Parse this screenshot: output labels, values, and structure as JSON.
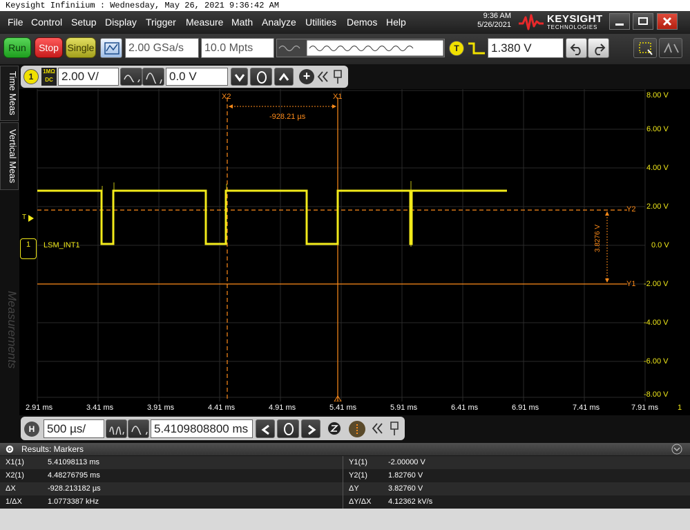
{
  "titlebar": {
    "text": "Keysight Infiniium : Wednesday, May 26, 2021 9:36:42 AM"
  },
  "menu": [
    "File",
    "Control",
    "Setup",
    "Display",
    "Trigger",
    "Measure",
    "Math",
    "Analyze",
    "Utilities",
    "Demos",
    "Help"
  ],
  "clock": {
    "time": "9:36 AM",
    "date": "5/26/2021"
  },
  "brand": {
    "name": "KEYSIGHT",
    "sub": "TECHNOLOGIES"
  },
  "toolbar": {
    "run": "Run",
    "stop": "Stop",
    "single": "Single",
    "sample_rate": "2.00 GSa/s",
    "memory_depth": "10.0 Mpts",
    "trigger_badge": "T",
    "trigger_level": "1.380 V"
  },
  "channel": {
    "number": "1",
    "coupling_top": "1MΩ",
    "coupling_bottom": "DC",
    "scale": "2.00 V/",
    "offset": "0.0 V"
  },
  "side_tabs": {
    "time": "Time Meas",
    "vertical": "Vertical Meas",
    "measurements": "Measurements"
  },
  "scope": {
    "trace_label": "LSM_INT1",
    "trigger_marker": "T",
    "channel_marker": "1",
    "x_labels": [
      "2.91 ms",
      "3.41 ms",
      "3.91 ms",
      "4.41 ms",
      "4.91 ms",
      "5.41 ms",
      "5.91 ms",
      "6.41 ms",
      "6.91 ms",
      "7.41 ms",
      "7.91 ms"
    ],
    "x_edge_label": "1",
    "y_labels": [
      "8.00 V",
      "6.00 V",
      "4.00 V",
      "2.00 V",
      "0.0 V",
      "-2.00 V",
      "-4.00 V",
      "-6.00 V",
      "-8.00 V"
    ],
    "markers": {
      "x1": "X1",
      "x2": "X2",
      "y1": "Y1",
      "y2": "Y2"
    },
    "delta_x_label": "-928.21 µs",
    "delta_y_label": "3.8276 V"
  },
  "horizontal": {
    "badge": "H",
    "scale": "500 µs/",
    "position": "5.4109808800 ms"
  },
  "results": {
    "header": "Results: Markers",
    "left": [
      {
        "label": "X1(1)",
        "value": "5.41098113 ms"
      },
      {
        "label": "X2(1)",
        "value": "4.48276795 ms"
      },
      {
        "label": "ΔX",
        "value": "-928.213182 µs"
      },
      {
        "label": "1/ΔX",
        "value": "1.0773387 kHz"
      }
    ],
    "right": [
      {
        "label": "Y1(1)",
        "value": "-2.00000 V"
      },
      {
        "label": "Y2(1)",
        "value": "1.82760 V"
      },
      {
        "label": "ΔY",
        "value": "3.82760 V"
      },
      {
        "label": "ΔY/ΔX",
        "value": "4.12362 kV/s"
      }
    ]
  },
  "colors": {
    "trace": "#f2ea1a",
    "marker": "#ff8c1a",
    "run": "#3fb83f",
    "stop": "#e53030",
    "single": "#c7c33a"
  }
}
